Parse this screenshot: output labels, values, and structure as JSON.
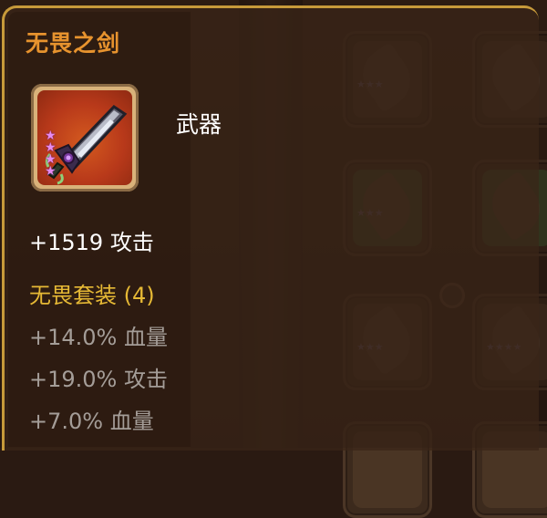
{
  "item": {
    "name": "无畏之剑",
    "type": "武器",
    "stars": 4,
    "icon": "sword-icon",
    "main_stat": "+1519 攻击"
  },
  "set": {
    "name": "无畏套装 (4)",
    "bonuses": [
      "+14.0% 血量",
      "+19.0% 攻击",
      "+7.0% 血量"
    ]
  },
  "colors": {
    "item_name": "#e7932e",
    "set_name": "#e6b935",
    "set_bonus": "#a49d98",
    "frame_border": "#c79a3a",
    "item_bg": "#b8391a",
    "star": "#e58bf0"
  }
}
